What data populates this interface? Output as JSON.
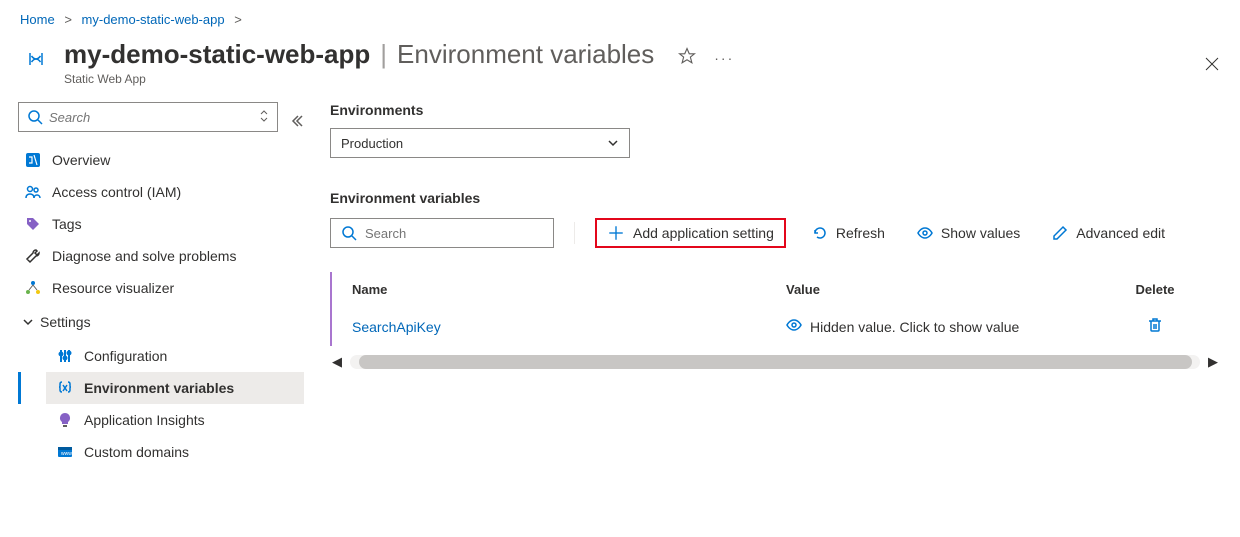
{
  "breadcrumb": {
    "home": "Home",
    "app": "my-demo-static-web-app"
  },
  "header": {
    "title_main": "my-demo-static-web-app",
    "title_suffix": "Environment variables",
    "subtitle": "Static Web App"
  },
  "sidebar": {
    "search_placeholder": "Search",
    "items": [
      {
        "label": "Overview"
      },
      {
        "label": "Access control (IAM)"
      },
      {
        "label": "Tags"
      },
      {
        "label": "Diagnose and solve problems"
      },
      {
        "label": "Resource visualizer"
      }
    ],
    "settings_group_label": "Settings",
    "settings_items": [
      {
        "label": "Configuration"
      },
      {
        "label": "Environment variables"
      },
      {
        "label": "Application Insights"
      },
      {
        "label": "Custom domains"
      }
    ]
  },
  "main": {
    "environments_label": "Environments",
    "environment_selected": "Production",
    "section_title": "Environment variables",
    "search_placeholder": "Search",
    "toolbar": {
      "add": "Add application setting",
      "refresh": "Refresh",
      "show_values": "Show values",
      "advanced_edit": "Advanced edit"
    },
    "table": {
      "col_name": "Name",
      "col_value": "Value",
      "col_delete": "Delete",
      "rows": [
        {
          "name": "SearchApiKey",
          "value_text": "Hidden value. Click to show value"
        }
      ]
    }
  }
}
